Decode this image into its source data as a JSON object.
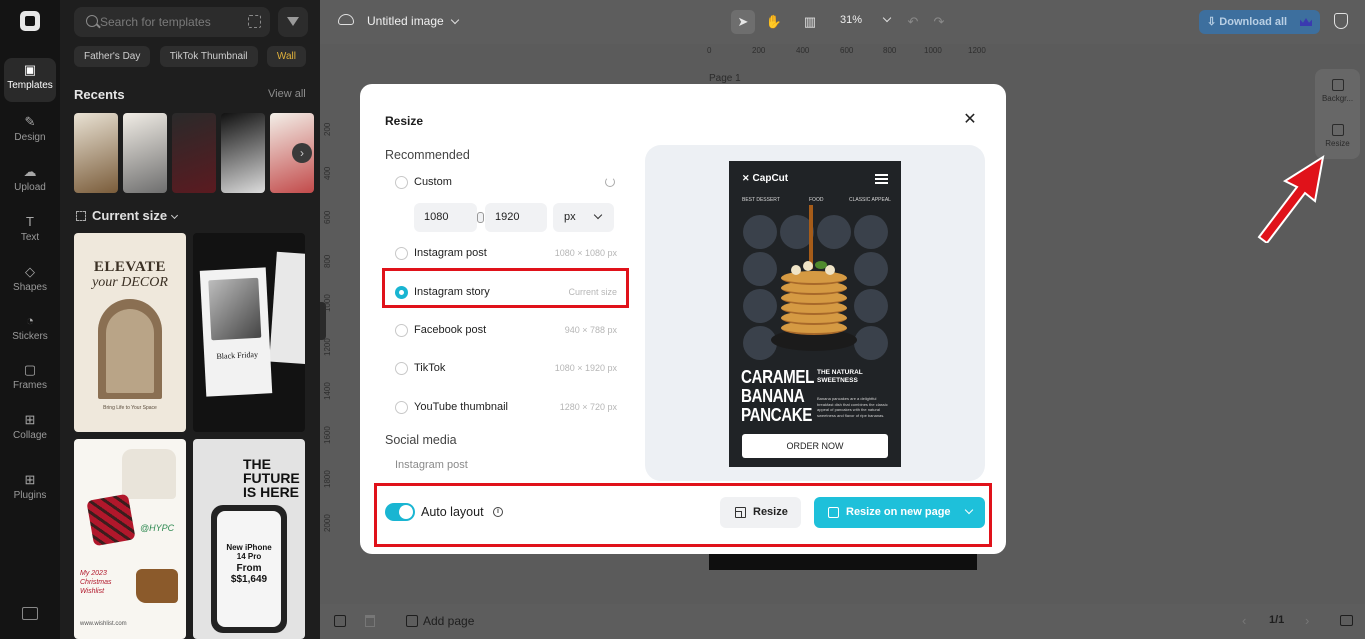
{
  "rail": {
    "items": [
      {
        "label": "Templates",
        "icon": "templates-icon",
        "glyph": "▣",
        "active": true
      },
      {
        "label": "Design",
        "icon": "design-icon",
        "glyph": "✎"
      },
      {
        "label": "Upload",
        "icon": "upload-icon",
        "glyph": "☁"
      },
      {
        "label": "Text",
        "icon": "text-icon",
        "glyph": "T"
      },
      {
        "label": "Shapes",
        "icon": "shapes-icon",
        "glyph": "◇"
      },
      {
        "label": "Stickers",
        "icon": "stickers-icon",
        "glyph": "◔"
      },
      {
        "label": "Frames",
        "icon": "frames-icon",
        "glyph": "▢"
      },
      {
        "label": "Collage",
        "icon": "collage-icon",
        "glyph": "⊞"
      },
      {
        "label": "Plugins",
        "icon": "plugins-icon",
        "glyph": "⊞"
      }
    ]
  },
  "panel": {
    "search_placeholder": "Search for templates",
    "chips": [
      "Father's Day",
      "TikTok Thumbnail",
      "Wall"
    ],
    "recents_title": "Recents",
    "view_all": "View all",
    "current_size": "Current size",
    "templates": {
      "elevate": {
        "line1": "ELEVATE",
        "line2": "your DECOR",
        "footer": "Bring Life to Your Space"
      },
      "friday": {
        "title": "Black Friday"
      },
      "xmas": {
        "handle": "@HYPC",
        "caption": "My 2023 Christmas Wishlist",
        "footer": "www.wishlist.com"
      },
      "future": {
        "headline": "THE FUTURE IS HERE",
        "phone_line1": "New iPhone 14 Pro",
        "phone_price": "From $$1,649"
      }
    }
  },
  "topbar": {
    "doc_title": "Untitled image",
    "zoom": "31%",
    "download_label": "Download all"
  },
  "canvas": {
    "ruler_top": [
      "0",
      "200",
      "400",
      "600",
      "800",
      "1000",
      "1200"
    ],
    "ruler_left": [
      "200",
      "400",
      "600",
      "800",
      "1000",
      "1200",
      "1400",
      "1600",
      "1800",
      "2000"
    ],
    "page_label": "Page 1"
  },
  "right_panel": {
    "background_label": "Backgr...",
    "resize_label": "Resize"
  },
  "bottombar": {
    "add_page": "Add page",
    "page_count": "1/1"
  },
  "modal": {
    "title": "Resize",
    "recommended": "Recommended",
    "options": [
      {
        "label": "Custom",
        "dims": ""
      },
      {
        "label": "Instagram post",
        "dims": "1080 × 1080 px"
      },
      {
        "label": "Instagram story",
        "dims": "Current size",
        "selected": true
      },
      {
        "label": "Facebook post",
        "dims": "940 × 788 px"
      },
      {
        "label": "TikTok",
        "dims": "1080 × 1920 px"
      },
      {
        "label": "YouTube thumbnail",
        "dims": "1280 × 720 px"
      }
    ],
    "width_value": "1080",
    "height_value": "1920",
    "unit": "px",
    "social_media": "Social media",
    "social_items": [
      "Instagram post"
    ],
    "auto_layout": "Auto layout",
    "auto_layout_on": true,
    "resize_button": "Resize",
    "resize_new_page_button": "Resize on new page",
    "accent_color": "#1ec0da",
    "highlight_color": "#e0121a"
  },
  "story": {
    "brand": "CapCut",
    "nav": [
      "BEST DESSERT",
      "FOOD",
      "CLASSIC APPEAL"
    ],
    "headline": [
      "CARAMEL",
      "BANANA",
      "PANCAKE"
    ],
    "subhead": [
      "THE NATURAL",
      "SWEETNESS"
    ],
    "body": "Banana pancakes are a delightful breakfast dish that combines the classic appeal of pancakes with the natural sweetness and flavor of ripe bananas.",
    "cta": "ORDER NOW"
  }
}
